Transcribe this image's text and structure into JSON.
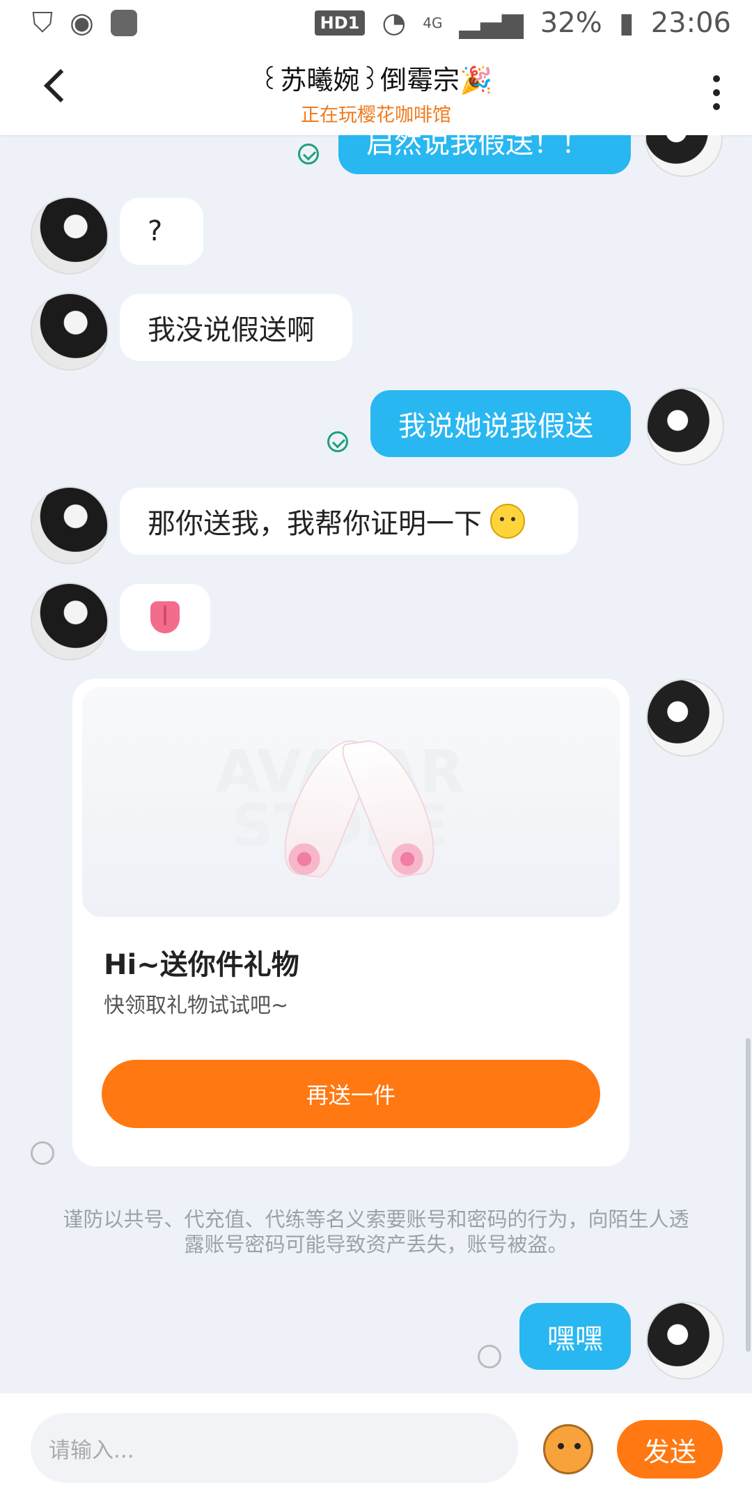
{
  "status_bar": {
    "battery": "32%",
    "time": "23:06",
    "network": "4G",
    "hd": "HD1"
  },
  "header": {
    "title": "꒰苏曦婉꒱倒霉宗🎉",
    "subtitle": "正在玩樱花咖啡馆"
  },
  "messages": [
    {
      "side": "out",
      "text": "启然说我假送！！"
    },
    {
      "side": "in",
      "text": "?"
    },
    {
      "side": "in",
      "text": "我没说假送啊"
    },
    {
      "side": "out",
      "text": "我说她说我假送"
    },
    {
      "side": "in",
      "text": "那你送我，我帮你证明一下"
    },
    {
      "side": "in",
      "text": "tongue-emoji"
    },
    {
      "side": "out",
      "text": "嘿嘿"
    }
  ],
  "gift_card": {
    "title": "Hi~送你件礼物",
    "subtitle": "快领取礼物试试吧~",
    "button": "再送一件",
    "watermark": "AVATAR STORE"
  },
  "warning": "谨防以共号、代充值、代练等名义索要账号和密码的行为，向陌生人透露账号密码可能导致资产丢失，账号被盗。",
  "input": {
    "placeholder": "请输入...",
    "send": "发送"
  },
  "colors": {
    "outgoing": "#28b7f1",
    "accent": "#ff7811",
    "sent_check": "#20a07a"
  }
}
